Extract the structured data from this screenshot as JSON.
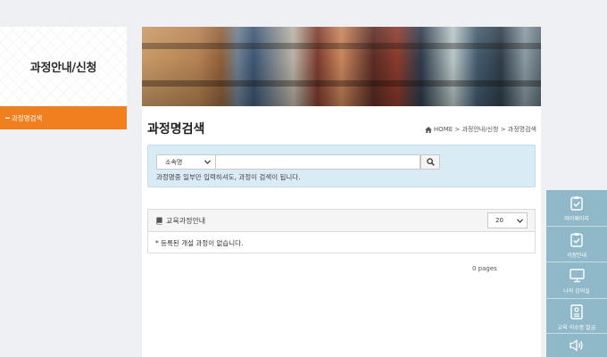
{
  "sidebar": {
    "title": "과정안내/신청",
    "active_item": "과정명검색",
    "active_marker": "━"
  },
  "main": {
    "page_title": "과정명검색",
    "breadcrumb": {
      "text": "HOME > 과정안내/신청 > 과정명검색"
    },
    "search": {
      "select_value": "소속명",
      "input_value": "",
      "help_text": "과정명중 일부만 입력하셔도, 과정이 검색이 됩니다."
    },
    "course_panel": {
      "title": "교육과정안내",
      "page_size": "20",
      "empty_message": "* 등록된 개설 과정이 없습니다."
    },
    "pages_info": "0 pages"
  },
  "quick_menu": {
    "items": [
      {
        "label": "마이페이지",
        "icon": "check-document-icon"
      },
      {
        "label": "과정안내",
        "icon": "check-document-icon"
      },
      {
        "label": "나의 강의실",
        "icon": "monitor-icon"
      },
      {
        "label": "교육 이수증 발급",
        "icon": "certificate-icon"
      },
      {
        "label": "",
        "icon": "speaker-icon"
      }
    ]
  },
  "colors": {
    "accent_orange": "#f07f1e",
    "search_bg": "#d9ebf5",
    "quick_menu_bg": "#8fb8c9"
  }
}
